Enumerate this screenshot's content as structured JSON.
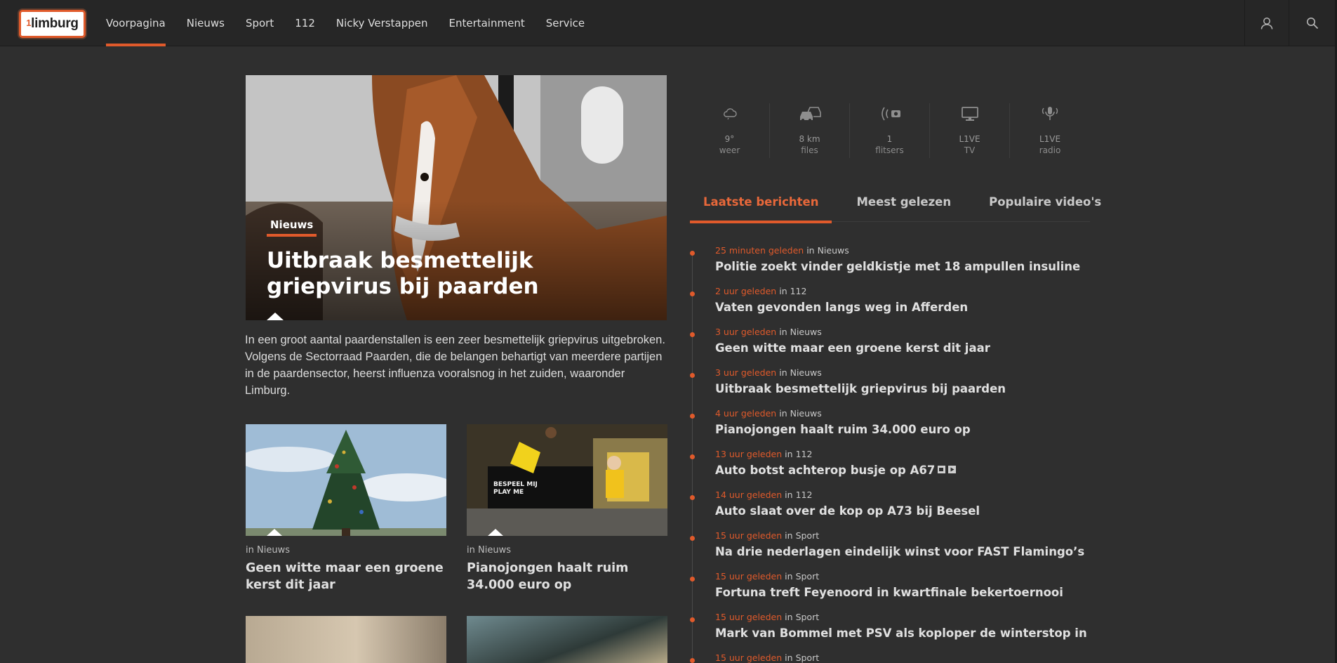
{
  "header": {
    "logo_text": "limburg",
    "logo_prefix": "1",
    "nav": [
      {
        "label": "Voorpagina",
        "active": true
      },
      {
        "label": "Nieuws"
      },
      {
        "label": "Sport"
      },
      {
        "label": "112"
      },
      {
        "label": "Nicky Verstappen"
      },
      {
        "label": "Entertainment"
      },
      {
        "label": "Service"
      }
    ],
    "icons": [
      "user-icon",
      "search-icon"
    ]
  },
  "hero": {
    "category": "Nieuws",
    "title": "Uitbraak besmettelijk griepvirus bij paarden",
    "intro": "In een groot aantal paardenstallen is een zeer besmettelijk griepvirus uitgebroken. Volgens de Sectorraad Paarden, die de belangen behartigt van meerdere partijen in de paardensector, heerst influenza vooralsnog in het zuiden, waaronder Limburg."
  },
  "cards": [
    {
      "in": "in",
      "category": "Nieuws",
      "title": "Geen witte maar een groene kerst dit jaar"
    },
    {
      "in": "in",
      "category": "Nieuws",
      "title": "Pianojongen haalt ruim 34.000 euro op",
      "image_text": "BESPEEL MIJ PLAY ME"
    }
  ],
  "widgets": [
    {
      "value": "9°",
      "label": "weer",
      "icon": "cloud-icon"
    },
    {
      "value": "8 km",
      "label": "files",
      "icon": "cars-icon"
    },
    {
      "value": "1",
      "label": "flitsers",
      "icon": "speedcam-icon"
    },
    {
      "value": "L1VE",
      "label": "TV",
      "icon": "tv-icon"
    },
    {
      "value": "L1VE",
      "label": "radio",
      "icon": "radio-icon"
    }
  ],
  "tabs": [
    {
      "label": "Laatste berichten",
      "active": true
    },
    {
      "label": "Meest gelezen"
    },
    {
      "label": "Populaire video's"
    }
  ],
  "news": [
    {
      "time": "25 minuten geleden",
      "in": "in",
      "category": "Nieuws",
      "title": "Politie zoekt vinder geldkistje met 18 ampullen insuline"
    },
    {
      "time": "2 uur geleden",
      "in": "in",
      "category": "112",
      "title": "Vaten gevonden langs weg in Afferden"
    },
    {
      "time": "3 uur geleden",
      "in": "in",
      "category": "Nieuws",
      "title": "Geen witte maar een groene kerst dit jaar"
    },
    {
      "time": "3 uur geleden",
      "in": "in",
      "category": "Nieuws",
      "title": "Uitbraak besmettelijk griepvirus bij paarden"
    },
    {
      "time": "4 uur geleden",
      "in": "in",
      "category": "Nieuws",
      "title": "Pianojongen haalt ruim 34.000 euro op"
    },
    {
      "time": "13 uur geleden",
      "in": "in",
      "category": "112",
      "title": "Auto botst achterop busje op A67",
      "media_icons": [
        "gallery-icon",
        "video-icon"
      ]
    },
    {
      "time": "14 uur geleden",
      "in": "in",
      "category": "112",
      "title": "Auto slaat over de kop op A73 bij Beesel"
    },
    {
      "time": "15 uur geleden",
      "in": "in",
      "category": "Sport",
      "title": "Na drie nederlagen eindelijk winst voor FAST Flamingo’s"
    },
    {
      "time": "15 uur geleden",
      "in": "in",
      "category": "Sport",
      "title": "Fortuna treft Feyenoord in kwartfinale bekertoernooi"
    },
    {
      "time": "15 uur geleden",
      "in": "in",
      "category": "Sport",
      "title": "Mark van Bommel met PSV als koploper de winterstop in"
    },
    {
      "time": "15 uur geleden",
      "in": "in",
      "category": "Sport",
      "title": ""
    }
  ],
  "colors": {
    "accent": "#e05a2b",
    "background": "#2f2f2f",
    "header": "#262626"
  }
}
